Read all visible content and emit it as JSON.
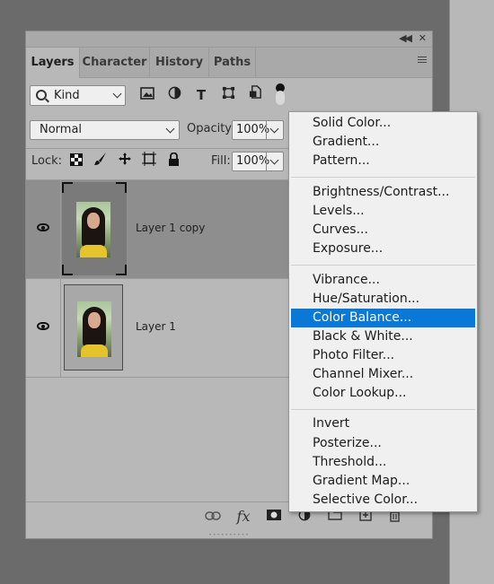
{
  "panel": {
    "tabs": [
      {
        "label": "Layers",
        "active": true
      },
      {
        "label": "Character",
        "active": false
      },
      {
        "label": "History",
        "active": false
      },
      {
        "label": "Paths",
        "active": false
      }
    ],
    "filter": {
      "kind_label": "Kind"
    },
    "blend_mode": "Normal",
    "opacity_label": "Opacity:",
    "opacity_value": "100%",
    "lock_label": "Lock:",
    "fill_label": "Fill:",
    "fill_value": "100%",
    "layers": [
      {
        "name": "Layer 1 copy",
        "selected": true,
        "visible": true
      },
      {
        "name": "Layer 1",
        "selected": false,
        "visible": true
      }
    ],
    "footer_fx_label": "fx"
  },
  "adjustment_menu": {
    "groups": [
      [
        "Solid Color...",
        "Gradient...",
        "Pattern..."
      ],
      [
        "Brightness/Contrast...",
        "Levels...",
        "Curves...",
        "Exposure..."
      ],
      [
        "Vibrance...",
        "Hue/Saturation...",
        "Color Balance...",
        "Black & White...",
        "Photo Filter...",
        "Channel Mixer...",
        "Color Lookup..."
      ],
      [
        "Invert",
        "Posterize...",
        "Threshold...",
        "Gradient Map...",
        "Selective Color..."
      ]
    ],
    "highlighted": "Color Balance...",
    "highlight_color": "#0a78d7"
  },
  "icons": {
    "titlebar": [
      "collapse-icon",
      "close-icon"
    ],
    "filters": [
      "image-filter-icon",
      "adjustment-filter-icon",
      "type-filter-icon",
      "shape-filter-icon",
      "smart-object-filter-icon"
    ],
    "locks": [
      "lock-transparent-pixels-icon",
      "lock-image-pixels-icon",
      "lock-position-icon",
      "lock-artboard-icon",
      "lock-all-icon"
    ],
    "footer": [
      "link-layers-icon",
      "fx-icon",
      "layer-mask-icon",
      "adjustment-layer-icon",
      "new-group-icon",
      "new-layer-icon",
      "delete-icon"
    ]
  }
}
